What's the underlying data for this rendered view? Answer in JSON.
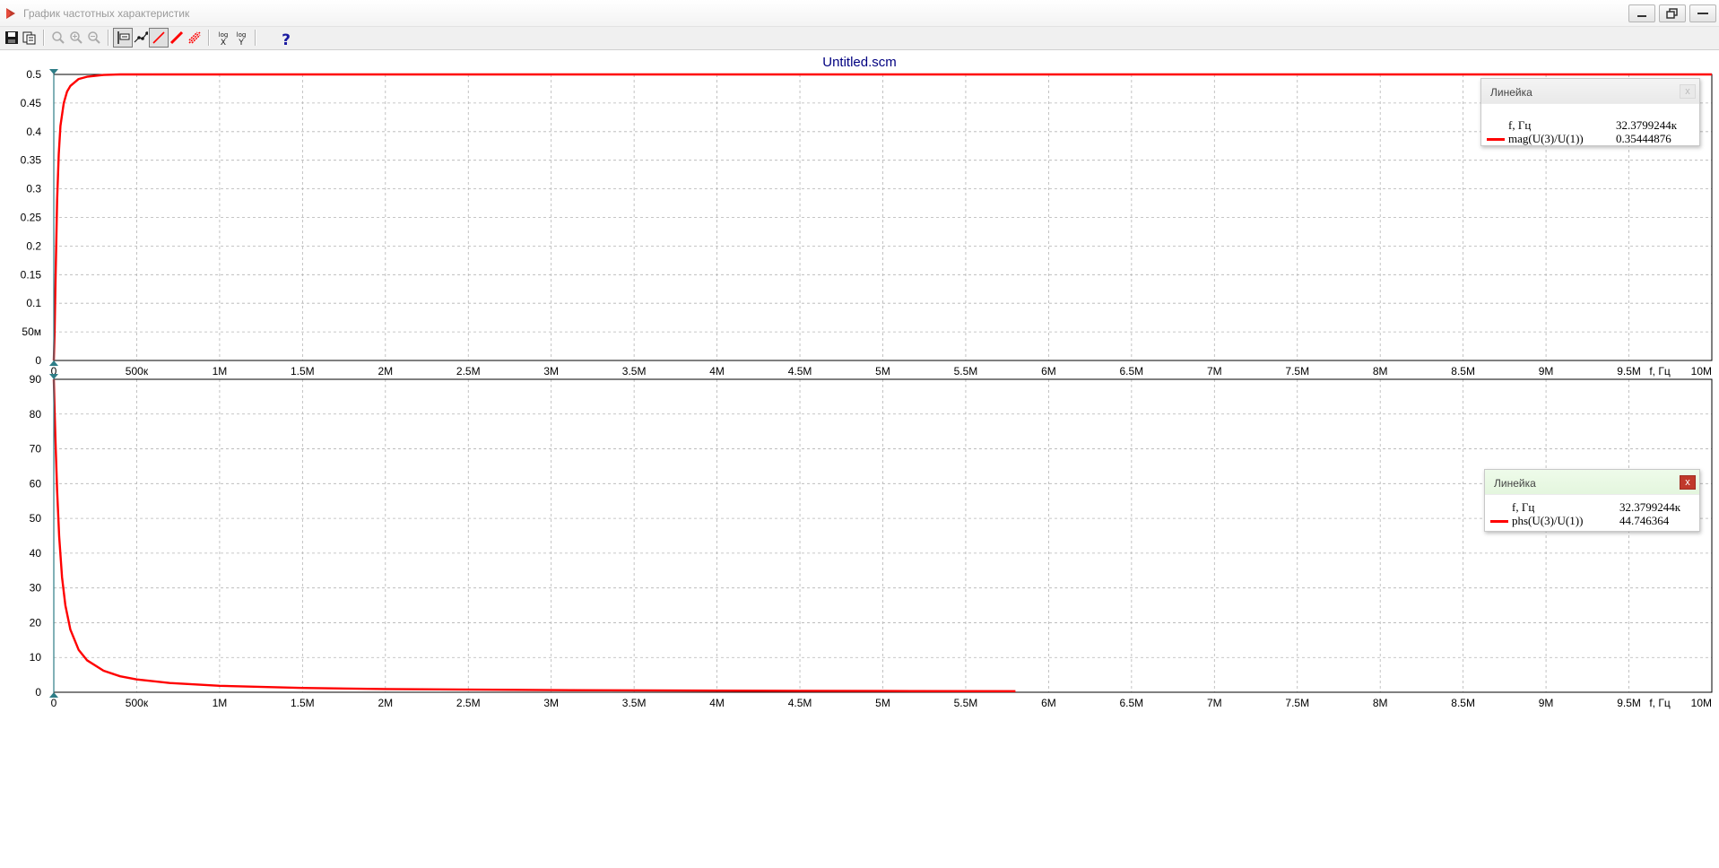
{
  "window": {
    "title": "График частотных характеристик",
    "icon": "red-triangle-icon"
  },
  "toolbar": {
    "buttons": [
      {
        "id": "save",
        "icon": "floppy-disk-icon"
      },
      {
        "id": "copy",
        "icon": "copy-icon"
      },
      {
        "id": "zoom",
        "icon": "zoom-icon"
      },
      {
        "id": "zoom-in",
        "icon": "zoom-in-icon"
      },
      {
        "id": "zoom-out",
        "icon": "zoom-out-icon"
      },
      {
        "id": "ruler",
        "icon": "ruler-icon"
      },
      {
        "id": "points",
        "icon": "points-icon"
      },
      {
        "id": "line",
        "icon": "line-icon"
      },
      {
        "id": "thick-line",
        "icon": "thick-line-icon"
      },
      {
        "id": "grid",
        "icon": "grid-icon"
      },
      {
        "id": "log-x",
        "icon": "log-x-icon",
        "label_top": "log",
        "label_bottom": "X"
      },
      {
        "id": "log-y",
        "icon": "log-y-icon",
        "label_top": "log",
        "label_bottom": "Y"
      },
      {
        "id": "help",
        "icon": "help-icon",
        "label": "?"
      }
    ]
  },
  "plot": {
    "title": "Untitled.scm",
    "colors": {
      "curve": "#ff0000",
      "grid": "#b4b4b4",
      "axis": "#000000",
      "marker": "#2e7d87",
      "title": "#000080"
    }
  },
  "chart_data": [
    {
      "type": "line",
      "xlabel": "f, Гц",
      "xlim": [
        0,
        10000000
      ],
      "ylim": [
        0,
        0.5
      ],
      "x_ticks": [
        {
          "value": 0,
          "label": "0"
        },
        {
          "value": 500000,
          "label": "500к"
        },
        {
          "value": 1000000,
          "label": "1M"
        },
        {
          "value": 1500000,
          "label": "1.5M"
        },
        {
          "value": 2000000,
          "label": "2M"
        },
        {
          "value": 2500000,
          "label": "2.5M"
        },
        {
          "value": 3000000,
          "label": "3M"
        },
        {
          "value": 3500000,
          "label": "3.5M"
        },
        {
          "value": 4000000,
          "label": "4M"
        },
        {
          "value": 4500000,
          "label": "4.5M"
        },
        {
          "value": 5000000,
          "label": "5M"
        },
        {
          "value": 5500000,
          "label": "5.5M"
        },
        {
          "value": 6000000,
          "label": "6M"
        },
        {
          "value": 6500000,
          "label": "6.5M"
        },
        {
          "value": 7000000,
          "label": "7M"
        },
        {
          "value": 7500000,
          "label": "7.5M"
        },
        {
          "value": 8000000,
          "label": "8M"
        },
        {
          "value": 8500000,
          "label": "8.5M"
        },
        {
          "value": 9000000,
          "label": "9M"
        },
        {
          "value": 9500000,
          "label": "9.5M"
        },
        {
          "value": 10000000,
          "label": "10M"
        }
      ],
      "y_ticks": [
        {
          "value": 0,
          "label": "0"
        },
        {
          "value": 0.05,
          "label": "50м"
        },
        {
          "value": 0.1,
          "label": "0.1"
        },
        {
          "value": 0.15,
          "label": "0.15"
        },
        {
          "value": 0.2,
          "label": "0.2"
        },
        {
          "value": 0.25,
          "label": "0.25"
        },
        {
          "value": 0.3,
          "label": "0.3"
        },
        {
          "value": 0.35,
          "label": "0.35"
        },
        {
          "value": 0.4,
          "label": "0.4"
        },
        {
          "value": 0.45,
          "label": "0.45"
        },
        {
          "value": 0.5,
          "label": "0.5"
        }
      ],
      "grid": true,
      "series": [
        {
          "name": "mag(U(3)/U(1))",
          "x": [
            0,
            5000,
            10000,
            20000,
            30000,
            40000,
            60000,
            80000,
            100000,
            150000,
            200000,
            300000,
            400000,
            600000
          ],
          "y": [
            0,
            0.05,
            0.13,
            0.28,
            0.36,
            0.41,
            0.45,
            0.47,
            0.48,
            0.492,
            0.496,
            0.499,
            0.5,
            0.5
          ]
        },
        {
          "name": "",
          "x": [
            600000,
            10000000
          ],
          "y": [
            0.5,
            0.5
          ]
        }
      ],
      "cursor_x": 0,
      "ruler": {
        "title": "Линейка",
        "rows": [
          {
            "name": "f, Гц",
            "value": "32.3799244к"
          },
          {
            "name": "mag(U(3)/U(1))",
            "value": "0.35444876"
          }
        ],
        "close_label": "x"
      }
    },
    {
      "type": "line",
      "xlabel": "f, Гц",
      "xlim": [
        0,
        10000000
      ],
      "ylim": [
        0,
        90
      ],
      "x_ticks": [
        {
          "value": 0,
          "label": "0"
        },
        {
          "value": 500000,
          "label": "500к"
        },
        {
          "value": 1000000,
          "label": "1M"
        },
        {
          "value": 1500000,
          "label": "1.5M"
        },
        {
          "value": 2000000,
          "label": "2M"
        },
        {
          "value": 2500000,
          "label": "2.5M"
        },
        {
          "value": 3000000,
          "label": "3M"
        },
        {
          "value": 3500000,
          "label": "3.5M"
        },
        {
          "value": 4000000,
          "label": "4M"
        },
        {
          "value": 4500000,
          "label": "4.5M"
        },
        {
          "value": 5000000,
          "label": "5M"
        },
        {
          "value": 5500000,
          "label": "5.5M"
        },
        {
          "value": 6000000,
          "label": "6M"
        },
        {
          "value": 6500000,
          "label": "6.5M"
        },
        {
          "value": 7000000,
          "label": "7M"
        },
        {
          "value": 7500000,
          "label": "7.5M"
        },
        {
          "value": 8000000,
          "label": "8M"
        },
        {
          "value": 8500000,
          "label": "8.5M"
        },
        {
          "value": 9000000,
          "label": "9M"
        },
        {
          "value": 9500000,
          "label": "9.5M"
        },
        {
          "value": 10000000,
          "label": "10M"
        }
      ],
      "y_ticks": [
        {
          "value": 0,
          "label": "0"
        },
        {
          "value": 10,
          "label": "10"
        },
        {
          "value": 20,
          "label": "20"
        },
        {
          "value": 30,
          "label": "30"
        },
        {
          "value": 40,
          "label": "40"
        },
        {
          "value": 50,
          "label": "50"
        },
        {
          "value": 60,
          "label": "60"
        },
        {
          "value": 70,
          "label": "70"
        },
        {
          "value": 80,
          "label": "80"
        },
        {
          "value": 90,
          "label": "90"
        }
      ],
      "grid": true,
      "series": [
        {
          "name": "phs(U(3)/U(1))",
          "x": [
            0,
            5000,
            10000,
            20000,
            32380,
            50000,
            70000,
            100000,
            150000,
            200000,
            300000,
            400000,
            500000,
            700000,
            1000000,
            1500000,
            2000000,
            3000000,
            4000000,
            5000000,
            5800000
          ],
          "y": [
            90,
            81,
            73,
            58,
            44.75,
            33,
            25,
            18,
            12.2,
            9.2,
            6.2,
            4.6,
            3.7,
            2.65,
            1.85,
            1.24,
            0.93,
            0.62,
            0.46,
            0.37,
            0.32
          ]
        }
      ],
      "cursor_x": 0,
      "ruler": {
        "title": "Линейка",
        "rows": [
          {
            "name": "f, Гц",
            "value": "32.3799244к"
          },
          {
            "name": "phs(U(3)/U(1))",
            "value": "44.746364"
          }
        ],
        "close_label": "x"
      }
    }
  ]
}
